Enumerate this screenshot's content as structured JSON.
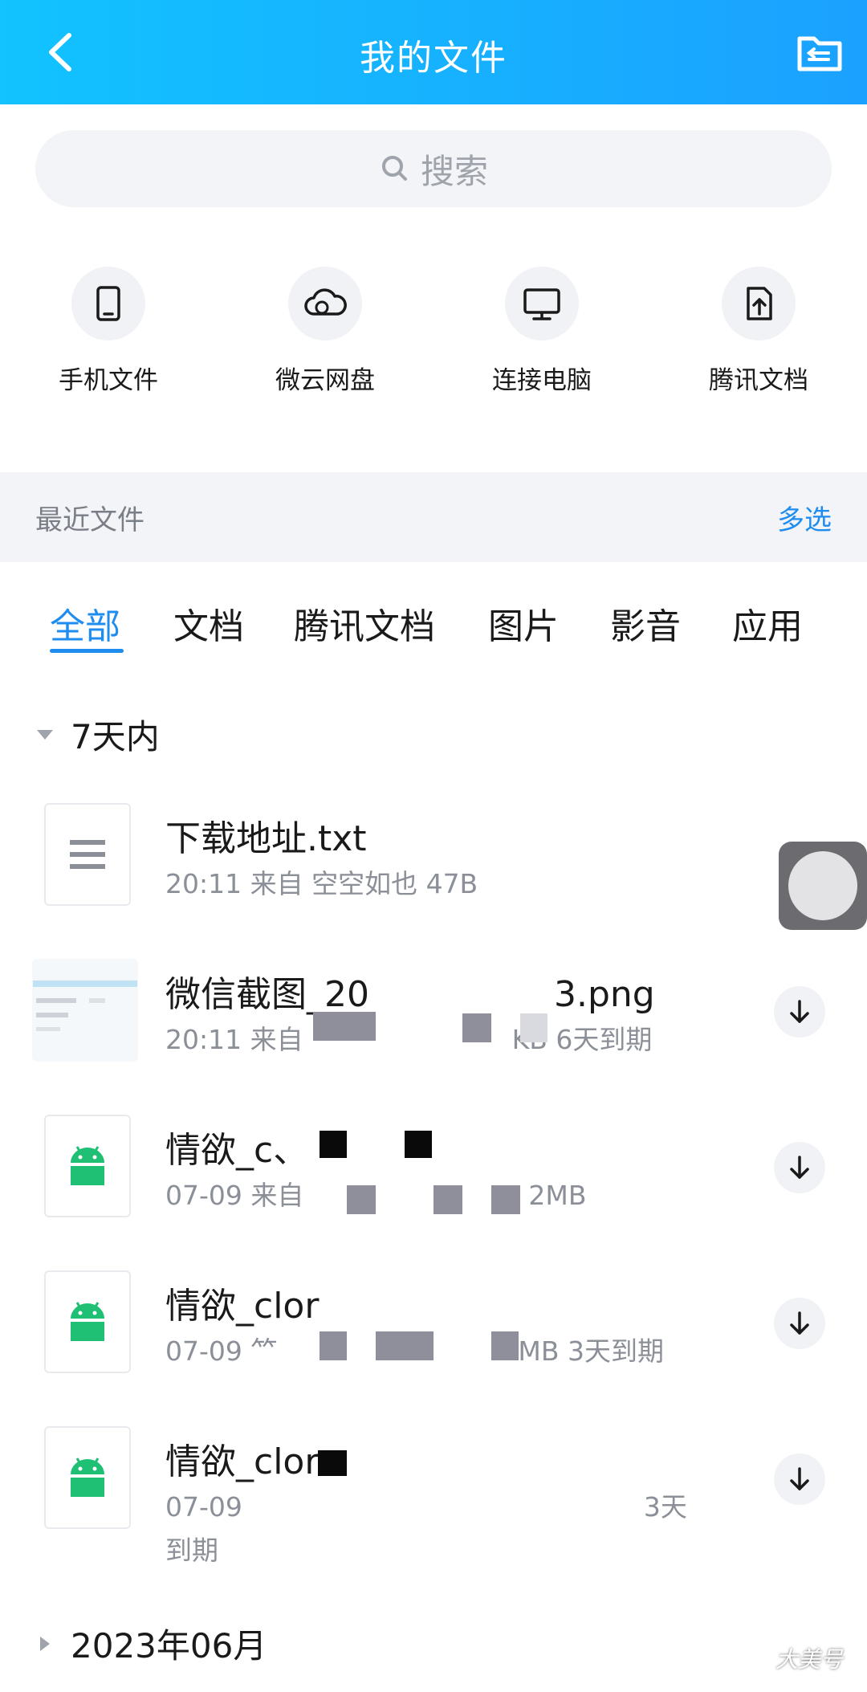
{
  "header": {
    "title": "我的文件",
    "back_icon": "chevron-left-icon",
    "folder_icon": "folder-icon"
  },
  "search": {
    "placeholder": "搜索"
  },
  "quick": [
    {
      "label": "手机文件",
      "icon": "phone-icon"
    },
    {
      "label": "微云网盘",
      "icon": "cloud-icon"
    },
    {
      "label": "连接电脑",
      "icon": "monitor-icon"
    },
    {
      "label": "腾讯文档",
      "icon": "doc-upload-icon"
    }
  ],
  "recent": {
    "label": "最近文件",
    "multi_select": "多选"
  },
  "tabs": [
    "全部",
    "文档",
    "腾讯文档",
    "图片",
    "影音",
    "应用"
  ],
  "groups": {
    "week": "7天内",
    "june": "2023年06月"
  },
  "files": [
    {
      "name": "下载地址.txt",
      "meta": "20:11  来自  空空如也  47B"
    },
    {
      "name": "微信截图_20",
      "name_tail": "3.png",
      "meta_time": "20:11  来自",
      "meta_tail": "KB  6天到期"
    },
    {
      "name": "情欲_c、",
      "meta_time": "07-09  来自",
      "meta_tail": "2MB"
    },
    {
      "name": "情欲_clor",
      "meta_time": "07-09  ⺮",
      "meta_tail": "MB  3天到期"
    },
    {
      "name": "情欲_clor",
      "meta_time": "07-09",
      "meta_tail": "3天",
      "meta_line2": "到期"
    }
  ],
  "colors": {
    "accent": "#1f8cf0",
    "header_start": "#12c3ff",
    "header_end": "#1ba1ff",
    "android": "#1fbf74"
  },
  "watermark": "大美号"
}
